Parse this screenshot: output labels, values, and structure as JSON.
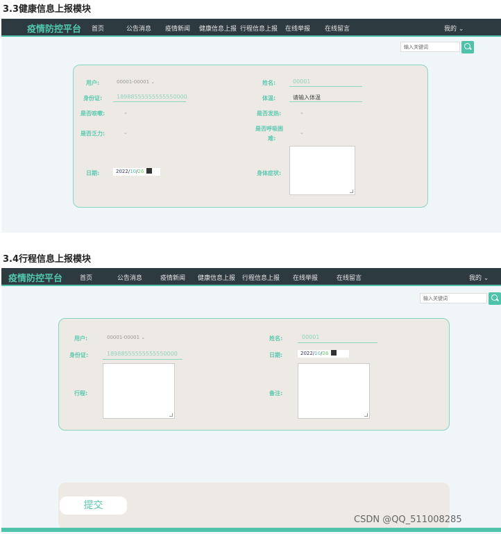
{
  "section1": {
    "heading": "3.3健康信息上报模块",
    "nav": {
      "brand": "疫情防控平台",
      "items": [
        "首页",
        "公告消息",
        "疫情新闻",
        "健康信息上报",
        "行程信息上报",
        "在线举报",
        "在线留言"
      ],
      "me": "我的 ⌄"
    },
    "search_placeholder": "输入关键词",
    "form": {
      "user_label": "用户:",
      "user_value": "00001-00001 ⌄",
      "name_label": "姓名:",
      "name_value": "00001",
      "id_label": "身份证:",
      "id_value": "18988555555555550000",
      "temp_label": "体温:",
      "temp_placeholder": "请输入体温",
      "cough_label": "是否咳嗽:",
      "fever_label": "是否发热:",
      "fatigue_label": "是否乏力:",
      "breath_label_1": "是否呼吸困",
      "breath_label_2": "难:",
      "date_label": "日期:",
      "date_year": "2022",
      "date_month": "10",
      "date_day": "26",
      "symptom_label": "身体症状:"
    }
  },
  "section2": {
    "heading": "3.4行程信息上报模块",
    "nav": {
      "brand": "疫情防控平台",
      "items": [
        "首页",
        "公告消息",
        "疫情新闻",
        "健康信息上报",
        "行程信息上报",
        "在线举报",
        "在线留言"
      ],
      "me": "我的 ⌄"
    },
    "search_placeholder": "输入关键词",
    "form": {
      "user_label": "用户:",
      "user_value": "00001-00001 ⌄",
      "name_label": "姓名:",
      "name_value": "00001",
      "id_label": "身份证:",
      "id_value": "18988555555555550000",
      "date_label": "日期:",
      "date_year": "2022",
      "date_month": "10",
      "date_day": "26",
      "trip_label": "行程:",
      "note_label": "备注:"
    },
    "submit_label": "提交"
  },
  "watermark": "CSDN @QQ_511008285",
  "colors": {
    "accent": "#4fc3aa",
    "nav_bg": "#2d3a3f",
    "panel_bg": "#ede9e4",
    "page_bg": "#f0f6f8"
  }
}
